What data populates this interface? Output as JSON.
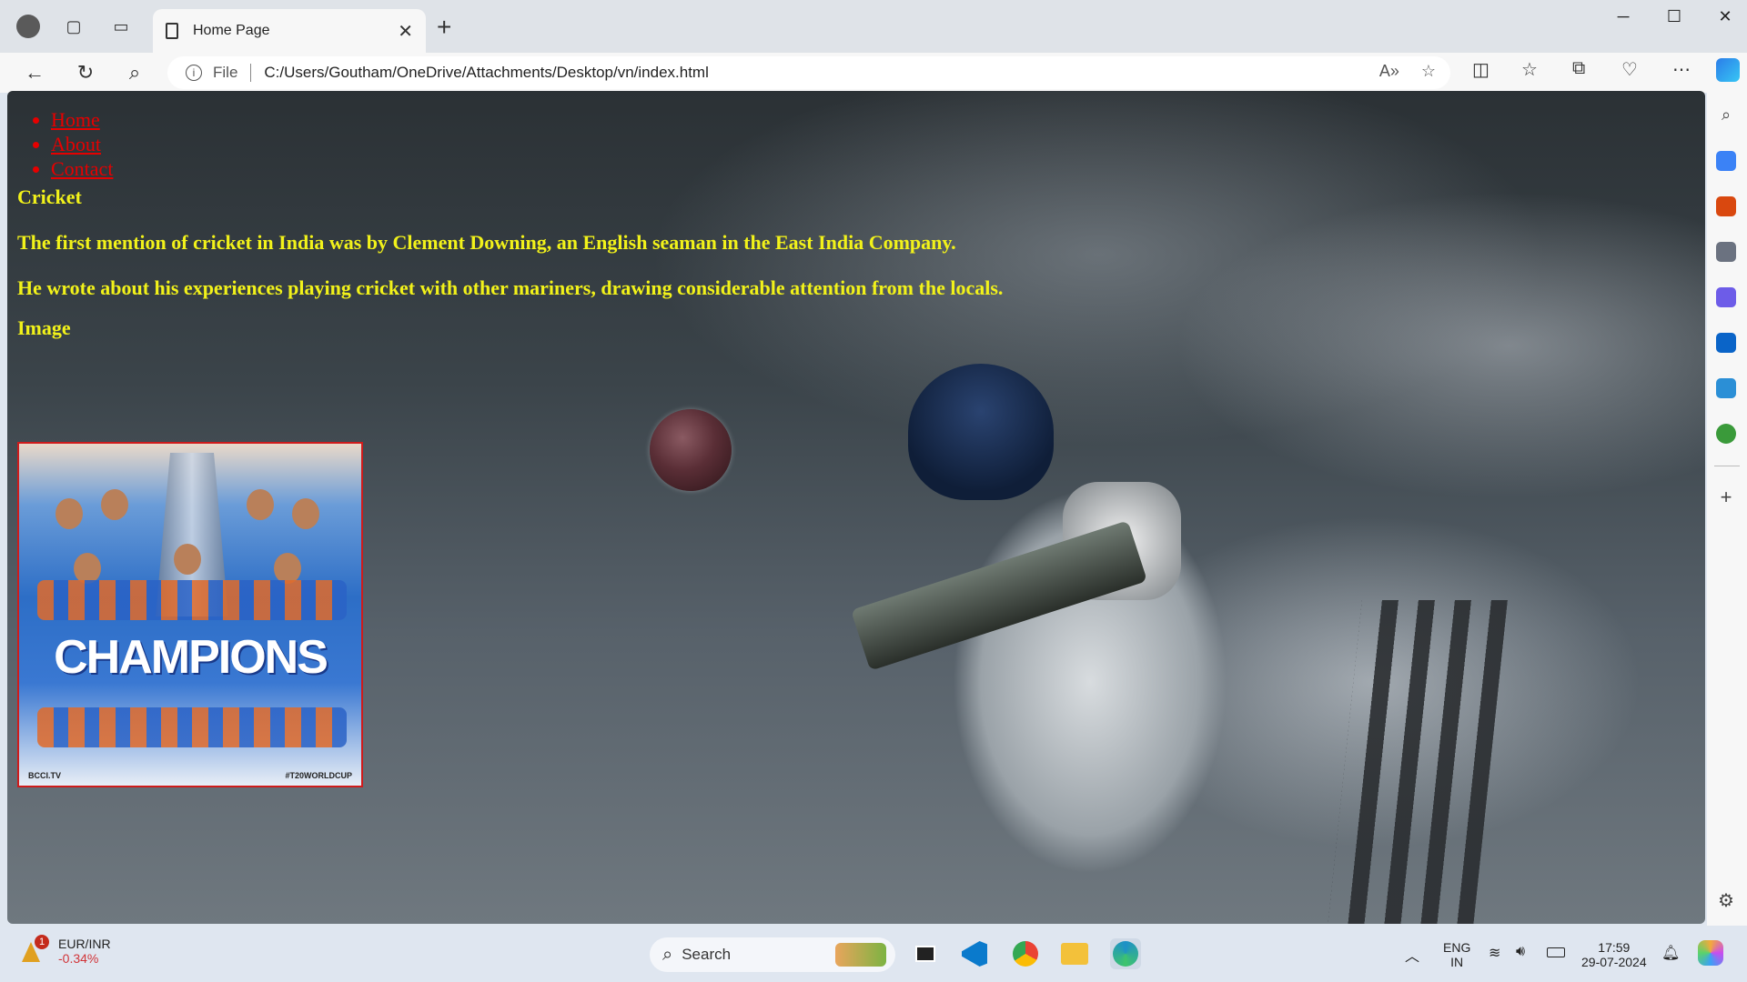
{
  "browser": {
    "tab_title": "Home Page",
    "address_scheme_label": "File",
    "address_url": "C:/Users/Goutham/OneDrive/Attachments/Desktop/vn/index.html"
  },
  "page": {
    "nav": [
      "Home",
      "About",
      "Contact"
    ],
    "heading_cricket": "Cricket",
    "para1": "The first mention of cricket in India was by Clement Downing, an English seaman in the East India Company.",
    "para2": "He wrote about his experiences playing cricket with other mariners, drawing considerable attention from the locals.",
    "heading_image": "Image",
    "poster": {
      "title": "CHAMPIONS",
      "caption_left": "BCCI.TV",
      "caption_right": "#T20WORLDCUP"
    }
  },
  "taskbar": {
    "stock_name": "EUR/INR",
    "stock_change": "-0.34%",
    "stock_badge": "1",
    "search_label": "Search",
    "lang_top": "ENG",
    "lang_bottom": "IN",
    "time": "17:59",
    "date": "29-07-2024"
  },
  "colors": {
    "page_text": "#f2f21a",
    "link": "#e60000",
    "stock_down": "#d13438"
  }
}
